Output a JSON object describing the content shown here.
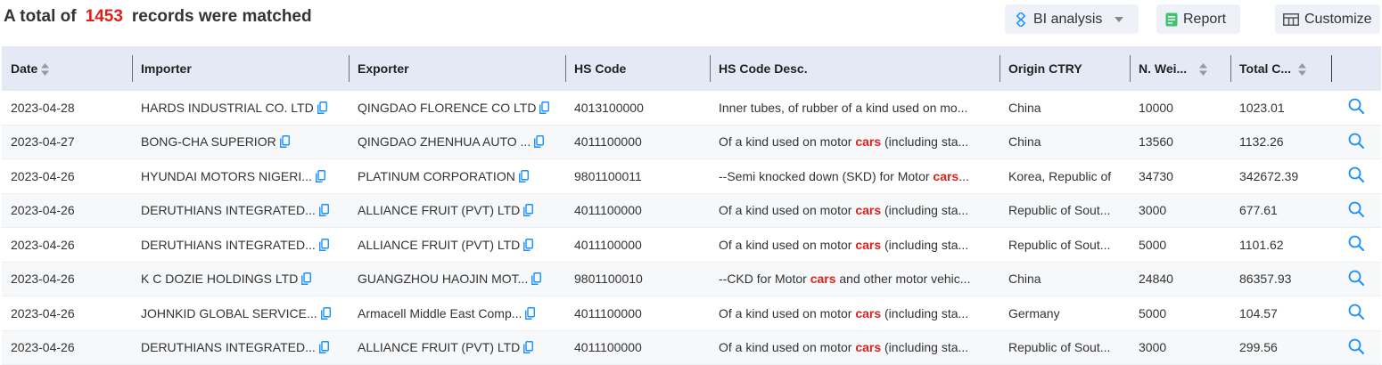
{
  "summary": {
    "prefix": "A total of",
    "count": "1453",
    "suffix": "records were matched"
  },
  "toolbar": {
    "bi_label": "BI analysis",
    "report_label": "Report",
    "customize_label": "Customize"
  },
  "colors": {
    "accent": "#1890ff",
    "highlight": "#e0201b",
    "header_bg": "#e4e9f5",
    "report_icon": "#3ec46d"
  },
  "columns": [
    "Date",
    "Importer",
    "Exporter",
    "HS Code",
    "HS Code Desc.",
    "Origin CTRY",
    "N. Wei...",
    "Total C..."
  ],
  "keyword": "cars",
  "rows": [
    {
      "date": "2023-04-28",
      "importer": "HARDS INDUSTRIAL CO. LTD",
      "exporter": "QINGDAO FLORENCE CO LTD",
      "hs": "4013100000",
      "desc_pre": "Inner tubes, of rubber of a kind used on mo...",
      "desc_kw": "",
      "desc_post": "",
      "origin": "China",
      "weight": "10000",
      "total": "1023.01"
    },
    {
      "date": "2023-04-27",
      "importer": "BONG-CHA SUPERIOR",
      "exporter": "QINGDAO ZHENHUA AUTO ...",
      "hs": "4011100000",
      "desc_pre": "Of a kind used on motor ",
      "desc_kw": "cars",
      "desc_post": " (including sta...",
      "origin": "China",
      "weight": "13560",
      "total": "1132.26"
    },
    {
      "date": "2023-04-26",
      "importer": "HYUNDAI MOTORS NIGERI...",
      "exporter": "PLATINUM CORPORATION",
      "hs": "9801100011",
      "desc_pre": "--Semi knocked down (SKD) for Motor ",
      "desc_kw": "cars",
      "desc_post": "...",
      "origin": "Korea, Republic of",
      "weight": "34730",
      "total": "342672.39"
    },
    {
      "date": "2023-04-26",
      "importer": "DERUTHIANS INTEGRATED...",
      "exporter": "ALLIANCE FRUIT (PVT) LTD",
      "hs": "4011100000",
      "desc_pre": "Of a kind used on motor ",
      "desc_kw": "cars",
      "desc_post": " (including sta...",
      "origin": "Republic of Sout...",
      "weight": "3000",
      "total": "677.61"
    },
    {
      "date": "2023-04-26",
      "importer": "DERUTHIANS INTEGRATED...",
      "exporter": "ALLIANCE FRUIT (PVT) LTD",
      "hs": "4011100000",
      "desc_pre": "Of a kind used on motor ",
      "desc_kw": "cars",
      "desc_post": " (including sta...",
      "origin": "Republic of Sout...",
      "weight": "5000",
      "total": "1101.62"
    },
    {
      "date": "2023-04-26",
      "importer": "K C DOZIE HOLDINGS LTD",
      "exporter": "GUANGZHOU HAOJIN MOT...",
      "hs": "9801100010",
      "desc_pre": "--CKD for Motor ",
      "desc_kw": "cars",
      "desc_post": " and other motor vehic...",
      "origin": "China",
      "weight": "24840",
      "total": "86357.93"
    },
    {
      "date": "2023-04-26",
      "importer": "JOHNKID GLOBAL SERVICE...",
      "exporter": "Armacell Middle East Comp...",
      "hs": "4011100000",
      "desc_pre": "Of a kind used on motor ",
      "desc_kw": "cars",
      "desc_post": " (including sta...",
      "origin": "Germany",
      "weight": "5000",
      "total": "104.57"
    },
    {
      "date": "2023-04-26",
      "importer": "DERUTHIANS INTEGRATED...",
      "exporter": "ALLIANCE FRUIT (PVT) LTD",
      "hs": "4011100000",
      "desc_pre": "Of a kind used on motor ",
      "desc_kw": "cars",
      "desc_post": " (including sta...",
      "origin": "Republic of Sout...",
      "weight": "3000",
      "total": "299.56"
    }
  ]
}
